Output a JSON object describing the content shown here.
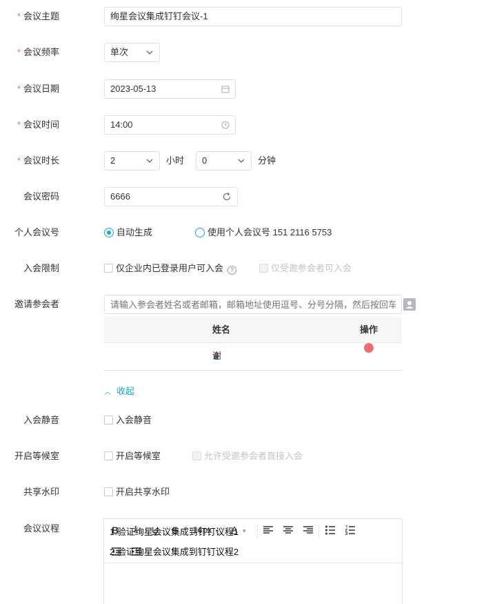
{
  "topic": {
    "label": "会议主题",
    "value": "绚星会议集成钉钉会议-1"
  },
  "frequency": {
    "label": "会议频率",
    "value": "单次"
  },
  "date": {
    "label": "会议日期",
    "value": "2023-05-13"
  },
  "time": {
    "label": "会议时间",
    "value": "14:00"
  },
  "duration": {
    "label": "会议时长",
    "hours": "2",
    "hours_unit": "小时",
    "minutes": "0",
    "minutes_unit": "分钟"
  },
  "password": {
    "label": "会议密码",
    "value": "6666"
  },
  "personal_id": {
    "label": "个人会议号",
    "option_auto": "自动生成",
    "option_personal": "使用个人会议号 151 2116 5753"
  },
  "join_limit": {
    "label": "入会限制",
    "option_login": "仅企业内已登录用户可入会",
    "option_invited": "仅受邀参会者可入会"
  },
  "invite": {
    "label": "邀请参会者",
    "placeholder": "请输入参会者姓名或者邮箱，邮箱地址使用逗号、分号分隔，然后按回车",
    "columns": {
      "name": "姓名",
      "action": "操作"
    },
    "rows": [
      {
        "name": "谢"
      }
    ]
  },
  "collapse_label": "收起",
  "mute": {
    "label": "入会静音",
    "option": "入会静音"
  },
  "waiting_room": {
    "label": "开启等候室",
    "option": "开启等候室",
    "option_direct": "允许受邀参会者直接入会"
  },
  "watermark": {
    "label": "共享水印",
    "option": "开启共享水印"
  },
  "agenda": {
    "label": "会议议程",
    "font_size": "14px",
    "lines": [
      "1.验证绚星会议集成到钉钉议程1",
      "2.验证绚星会议集成到钉钉议程2"
    ]
  },
  "colors": {
    "required": "#f56c6c",
    "accent": "#13a7d9",
    "danger": "#f36c6c"
  }
}
